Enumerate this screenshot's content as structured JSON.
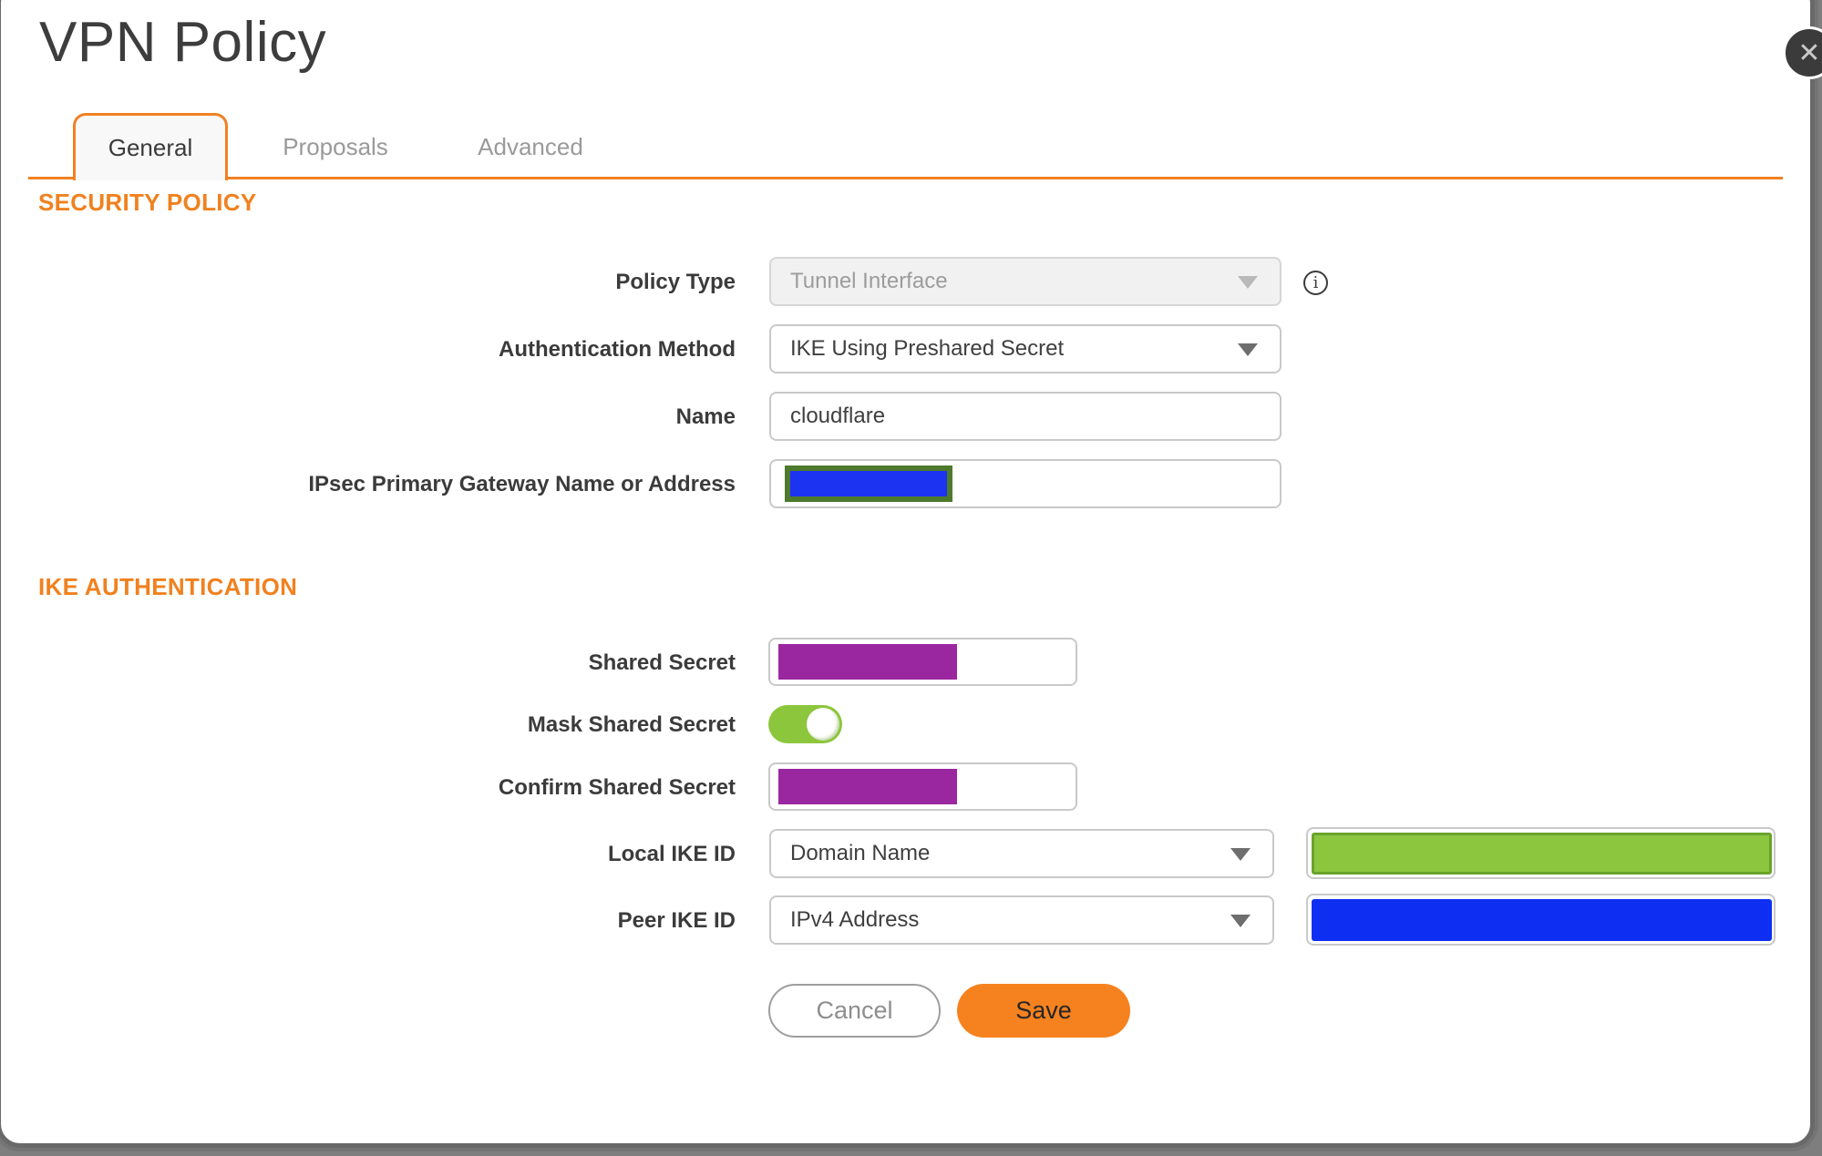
{
  "dialog": {
    "title": "VPN Policy",
    "close_icon": "✕"
  },
  "tabs": [
    {
      "label": "General",
      "active": true
    },
    {
      "label": "Proposals",
      "active": false
    },
    {
      "label": "Advanced",
      "active": false
    }
  ],
  "sections": {
    "security_policy": "SECURITY POLICY",
    "ike_authentication": "IKE AUTHENTICATION"
  },
  "fields": {
    "policy_type": {
      "label": "Policy Type",
      "value": "Tunnel Interface",
      "disabled": true,
      "info_icon": "i"
    },
    "authentication_method": {
      "label": "Authentication Method",
      "value": "IKE Using Preshared Secret"
    },
    "name": {
      "label": "Name",
      "value": "cloudflare"
    },
    "gateway": {
      "label": "IPsec Primary Gateway Name or Address",
      "value": "",
      "redacted": true
    },
    "shared_secret": {
      "label": "Shared Secret",
      "value": "",
      "redacted": true
    },
    "mask_shared_secret": {
      "label": "Mask Shared Secret",
      "enabled": true
    },
    "confirm_shared_secret": {
      "label": "Confirm Shared Secret",
      "value": "",
      "redacted": true
    },
    "local_ike_id": {
      "label": "Local IKE ID",
      "type_value": "Domain Name",
      "value": "",
      "redacted": true
    },
    "peer_ike_id": {
      "label": "Peer IKE ID",
      "type_value": "IPv4 Address",
      "value": "",
      "redacted": true
    }
  },
  "buttons": {
    "cancel": "Cancel",
    "save": "Save"
  },
  "colors": {
    "accent_orange": "#EF8122",
    "section_header_orange": "#F0811F",
    "save_orange": "#F6821F",
    "redaction_blue": "#1C33F2",
    "redaction_blue_border": "#4E7A2D",
    "redaction_purple": "#9B27A0",
    "redaction_green": "#8CC63F",
    "redaction_green_border": "#69A32B",
    "toggle_green": "#8CC63C",
    "frame_gray": "#696969",
    "close_button_bg": "#3B3B3B"
  }
}
